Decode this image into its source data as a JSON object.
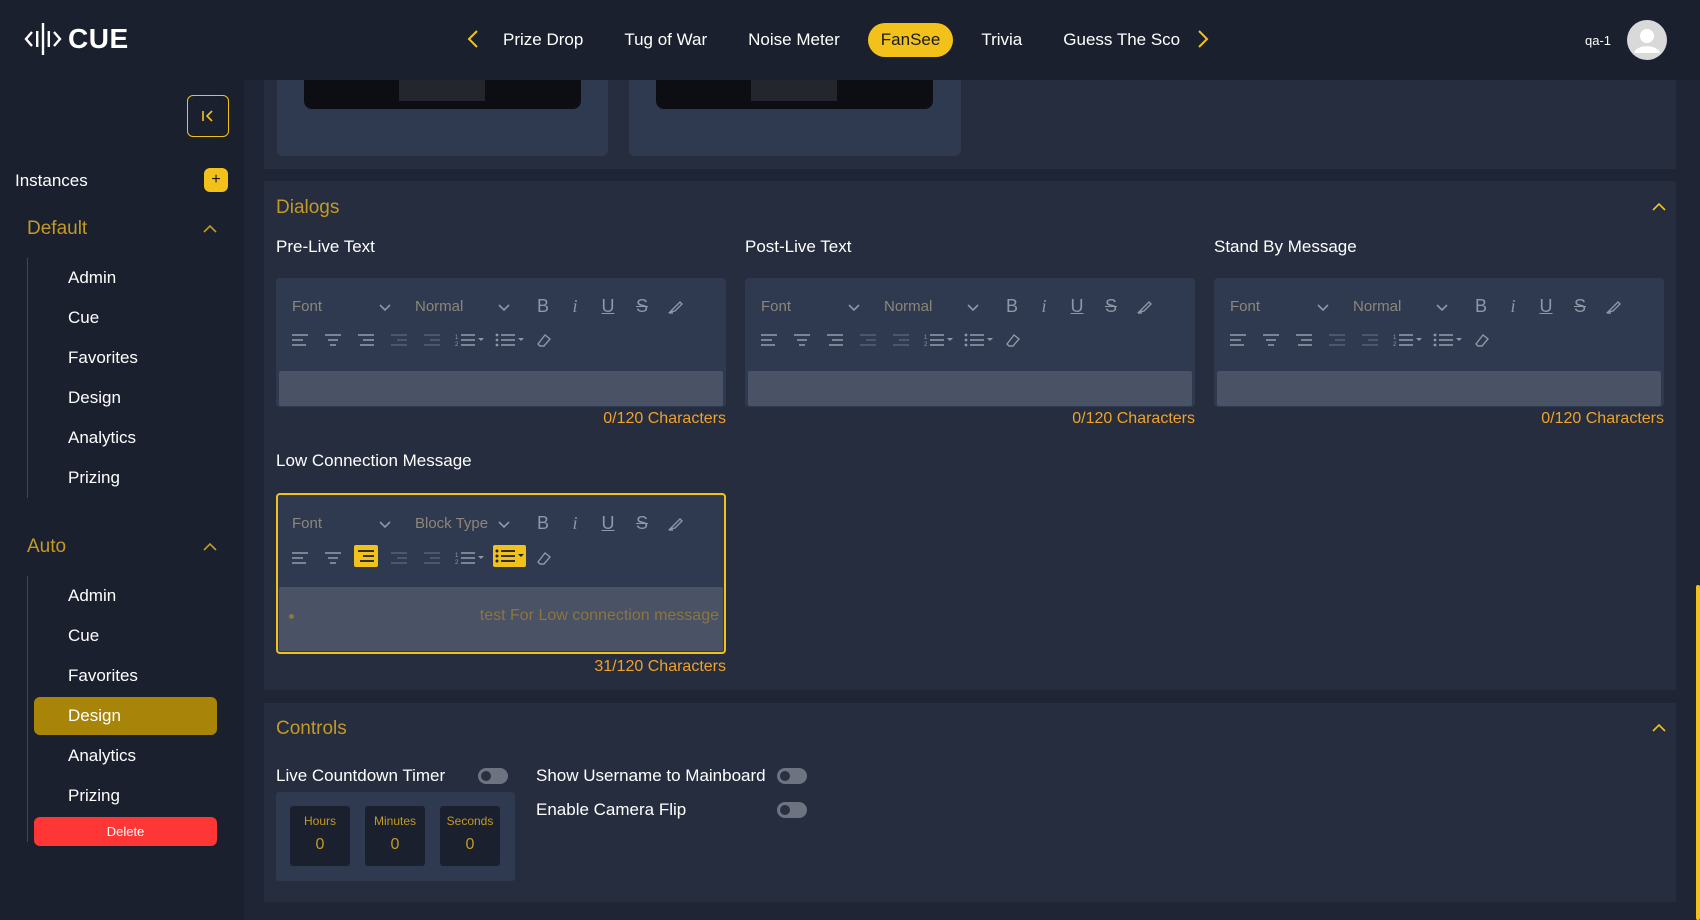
{
  "colors": {
    "accent": "#f2c21b",
    "danger": "#ff3636",
    "section_title": "#c39a25",
    "char_count": "#f0a22a"
  },
  "header": {
    "logo_text": "CUE",
    "tabs": [
      {
        "label": "Prize Drop"
      },
      {
        "label": "Tug of War"
      },
      {
        "label": "Noise Meter"
      },
      {
        "label": "FanSee"
      },
      {
        "label": "Trivia"
      },
      {
        "label": "Guess The Score"
      }
    ],
    "active_tab": "FanSee",
    "user": "qa-1",
    "icons": {
      "prev": "chevron-left-icon",
      "next": "chevron-right-icon",
      "avatar": "user-avatar-icon"
    }
  },
  "sidebar": {
    "instances_label": "Instances",
    "add_label": "+",
    "groups": [
      {
        "title": "Default",
        "items": [
          "Admin",
          "Cue",
          "Favorites",
          "Design",
          "Analytics",
          "Prizing"
        ]
      },
      {
        "title": "Auto",
        "items": [
          "Admin",
          "Cue",
          "Favorites",
          "Design",
          "Analytics",
          "Prizing"
        ],
        "active_item": "Design"
      }
    ],
    "delete_label": "Delete"
  },
  "dialogs": {
    "title": "Dialogs",
    "fields": [
      {
        "label": "Pre-Live Text",
        "font": "Font",
        "block": "Normal",
        "value": "",
        "count": "0/120 Characters"
      },
      {
        "label": "Post-Live Text",
        "font": "Font",
        "block": "Normal",
        "value": "",
        "count": "0/120 Characters"
      },
      {
        "label": "Stand By Message",
        "font": "Font",
        "block": "Normal",
        "value": "",
        "count": "0/120 Characters"
      },
      {
        "label": "Low Connection Message",
        "font": "Font",
        "block": "Block Type",
        "value": "test For Low connection message",
        "count": "31/120 Characters"
      }
    ]
  },
  "controls": {
    "title": "Controls",
    "live_countdown_label": "Live Countdown Timer",
    "show_username_label": "Show Username to Mainboard",
    "camera_flip_label": "Enable Camera Flip",
    "timer": [
      {
        "label": "Hours",
        "value": "0"
      },
      {
        "label": "Minutes",
        "value": "0"
      },
      {
        "label": "Seconds",
        "value": "0"
      }
    ]
  }
}
